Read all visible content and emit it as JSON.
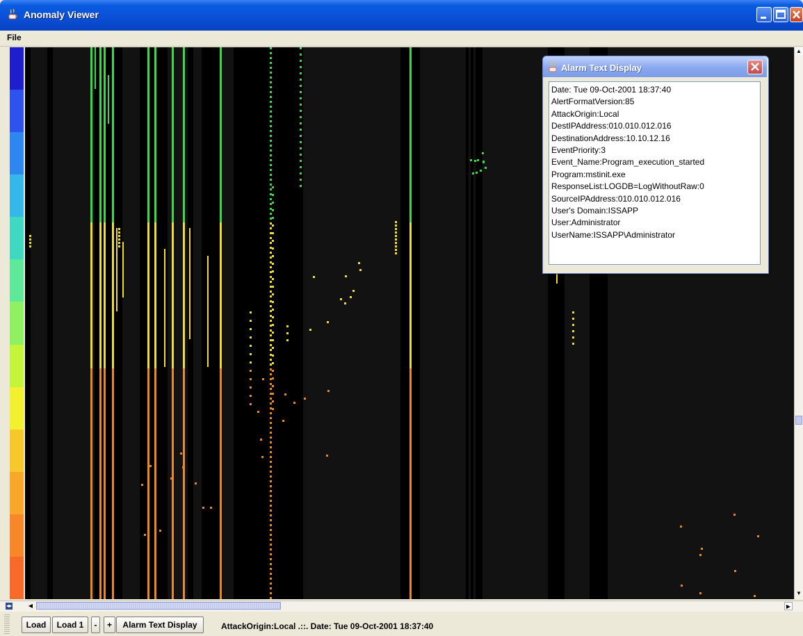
{
  "window": {
    "title": "Anomaly Viewer"
  },
  "menu": {
    "items": [
      "File"
    ]
  },
  "alarm_window": {
    "title": "Alarm Text Display",
    "lines": [
      "Date: Tue 09-Oct-2001 18:37:40",
      "AlertFormatVersion:85",
      "AttackOrigin:Local",
      "DestIPAddress:010.010.012.016",
      "DestinationAddress:10.10.12.16",
      "EventPriority:3",
      "Event_Name:Program_execution_started",
      "Program:mstinit.exe",
      "ResponseList:LOGDB=LogWithoutRaw:0",
      "SourceIPAddress:010.010.012.016",
      "User's Domain:ISSAPP",
      "User:Administrator",
      "UserName:ISSAPP\\Administrator"
    ]
  },
  "toolbar": {
    "load_label": "Load",
    "load1_label": "Load 1",
    "minus_label": "-",
    "plus_label": "+",
    "alarm_label": "Alarm Text Display"
  },
  "status": {
    "text": "AttackOrigin:Local .::. Date: Tue 09-Oct-2001 18:37:40"
  },
  "icons": {
    "app": "java-coffee-cup-icon",
    "minimize": "minimize-icon",
    "maximize": "maximize-icon",
    "close": "close-icon",
    "scroll": [
      "scroll-up-icon",
      "scroll-down-icon",
      "scroll-left-icon",
      "scroll-right-icon"
    ]
  },
  "colors": {
    "canvas_bg": "#121212",
    "canvas_dark_column": "#000000",
    "legend": [
      "#1e1ecd",
      "#2d52ee",
      "#2e86f0",
      "#35b8e8",
      "#3fd8c2",
      "#5fe89a",
      "#8ff062",
      "#c4f53a",
      "#f3f030",
      "#f7c82c",
      "#f8a72a",
      "#f8872a",
      "#f76a2a"
    ],
    "mark_high": "#3bd94a",
    "mark_mid": "#f1dd2b",
    "mark_low": "#e9891f"
  }
}
